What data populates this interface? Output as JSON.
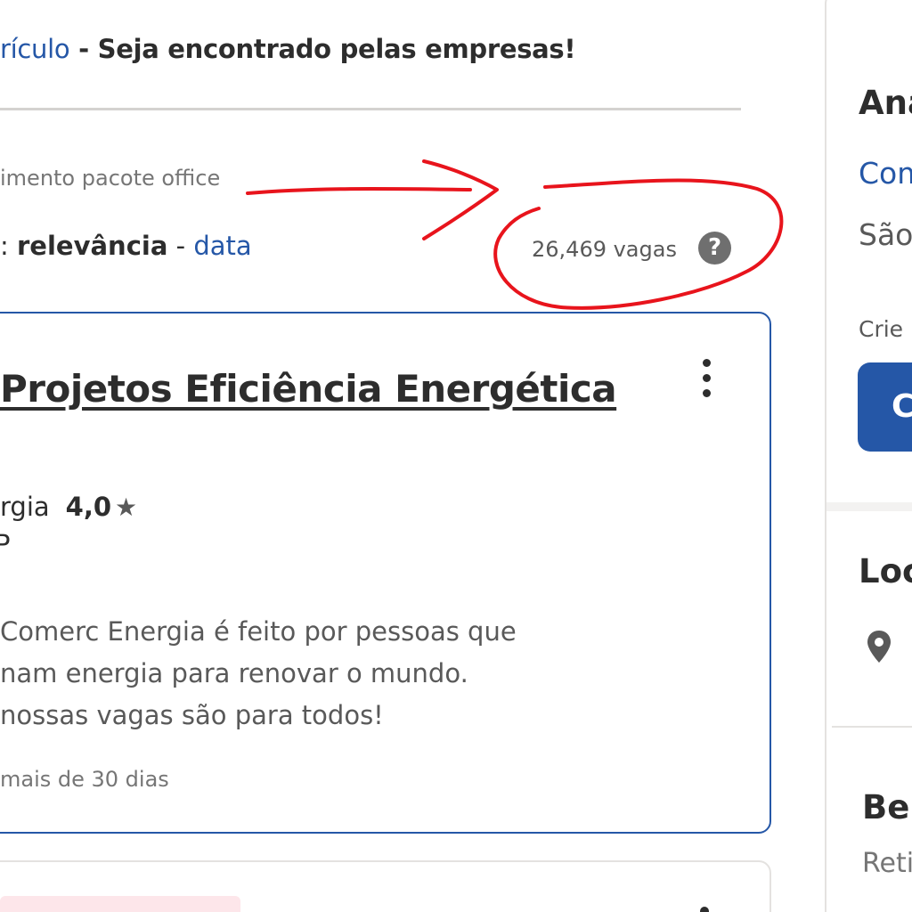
{
  "banner": {
    "link_text": "rículo",
    "rest_text": " - Seja encontrado pelas empresas!"
  },
  "search": {
    "term_text": "imento pacote office",
    "sort_prefix": ": ",
    "sort_active": "relevância",
    "sort_separator": " - ",
    "sort_other": "data",
    "job_count": "26,469 vagas",
    "help_glyph": "?"
  },
  "job_card": {
    "title": " Projetos Eficiência Energética",
    "company": "rgia",
    "rating": "4,0",
    "star_glyph": "★",
    "location": "P",
    "snippet_lines": [
      " Comerc Energia é feito por pessoas que",
      "nam energia para renovar o mundo.",
      "nossas vagas são para todos!"
    ],
    "posted": "mais de 30 dias"
  },
  "right_panel": {
    "title": "Ana",
    "company": "Com",
    "location": "São",
    "create_text": "Crie u",
    "button_label": "C",
    "section_location": "Loc",
    "section_benefits": "Be",
    "benefits_sub": "Reti"
  },
  "colors": {
    "link": "#2557a7",
    "annotation": "#e8141c",
    "text": "#2d2d2d"
  },
  "icons": {
    "help": "question-circle-icon",
    "star": "star-icon",
    "more": "kebab-menu-icon",
    "location": "map-pin-icon"
  }
}
